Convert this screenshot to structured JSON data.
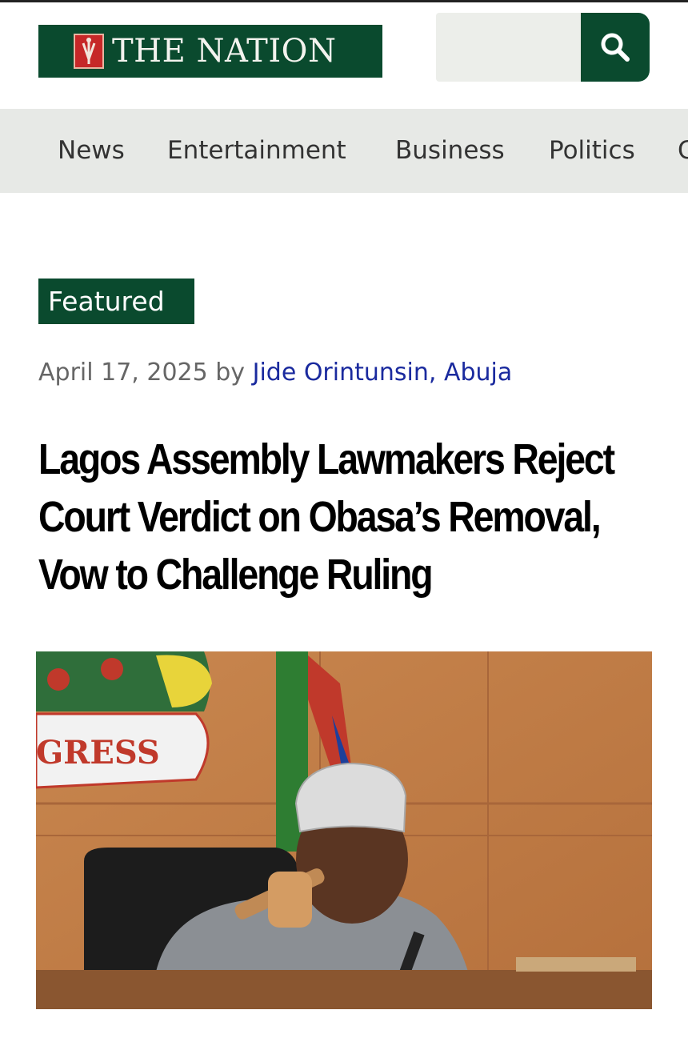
{
  "header": {
    "logo_text": "THE NATION",
    "search": {
      "placeholder": "",
      "icon": "search-icon"
    }
  },
  "nav": {
    "items": [
      {
        "label": "News"
      },
      {
        "label": "Entertainment"
      },
      {
        "label": "Business"
      },
      {
        "label": "Politics"
      },
      {
        "label": "C"
      }
    ]
  },
  "article": {
    "category": "Featured",
    "date": "April 17, 2025",
    "by": "by",
    "author": "Jide Orintunsin, Abuja",
    "title": "Lagos Assembly Lawmakers Reject Court Verdict on Obasa’s Removal, Vow to Challenge Ruling",
    "image": {
      "sign_text": "GRESS"
    }
  },
  "colors": {
    "brand_green": "#0a4a2e",
    "author_link": "#1a2a9e",
    "nav_bg": "#e7e9e6"
  }
}
